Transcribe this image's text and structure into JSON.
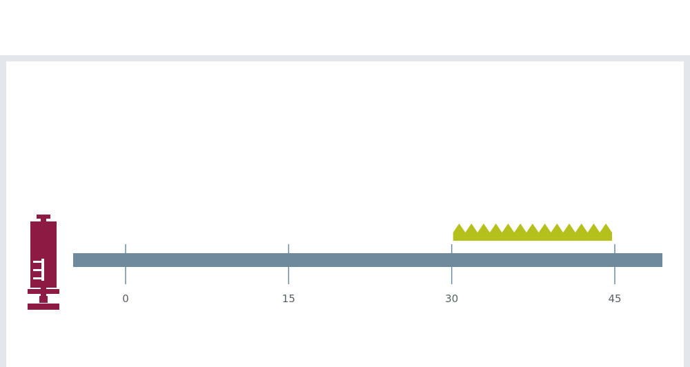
{
  "timeline": {
    "ticks": [
      {
        "value": 0,
        "label": "0"
      },
      {
        "value": 15,
        "label": "15"
      },
      {
        "value": 30,
        "label": "30"
      },
      {
        "value": 45,
        "label": "45"
      }
    ],
    "range": [
      0,
      45
    ],
    "highlight": {
      "start": 30,
      "end": 45,
      "peaks": 13
    }
  },
  "icons": {
    "injection": "syringe-icon"
  },
  "colors": {
    "bar": "#6e8a9c",
    "tick": "#6e8a9c",
    "syringe": "#8c1a43",
    "highlight": "#b5c01c",
    "frame": "#e3e6ea",
    "label": "#5a5f66"
  }
}
